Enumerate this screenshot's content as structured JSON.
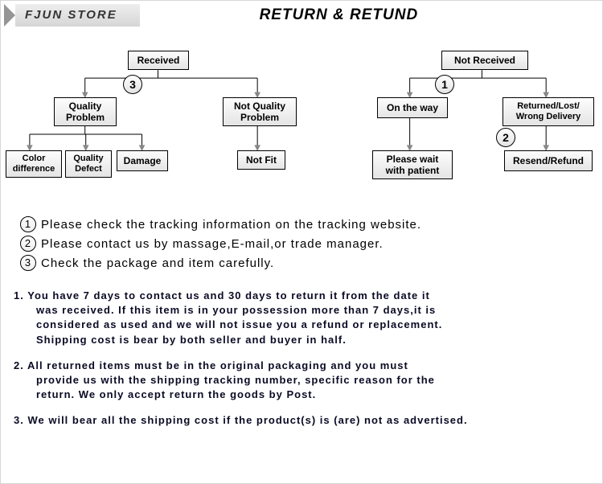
{
  "header": {
    "store_name": "FJUN STORE",
    "title": "RETURN & RETUND"
  },
  "diagram": {
    "left": {
      "root": "Received",
      "step_num": "3",
      "child1": "Quality\nProblem",
      "child2": "Not Quality\nProblem",
      "leaf1": "Color\ndifference",
      "leaf2": "Quality\nDefect",
      "leaf3": "Damage",
      "leaf4": "Not Fit"
    },
    "right": {
      "root": "Not  Received",
      "step_num1": "1",
      "step_num2": "2",
      "child1": "On the way",
      "child2": "Returned/Lost/\nWrong Delivery",
      "leaf1": "Please wait\nwith patient",
      "leaf2": "Resend/Refund"
    }
  },
  "notes": {
    "n1_num": "1",
    "n1": "Please check the tracking information on the tracking website.",
    "n2_num": "2",
    "n2": "Please contact us by  massage,E-mail,or trade manager.",
    "n3_num": "3",
    "n3": "Check the package and item carefully."
  },
  "policy": {
    "p1_label": "1.",
    "p1_a": "You have 7 days to contact us and 30 days to return it from the date it",
    "p1_b": "was received. If this item is in your possession more than 7 days,it is",
    "p1_c": "considered as used and we will not issue you a refund or replacement.",
    "p1_d": "Shipping cost is bear by both seller and buyer in half.",
    "p2_label": "2.",
    "p2_a": "All returned items must be in the original packaging and you must",
    "p2_b": "provide us with the shipping tracking number, specific reason for the",
    "p2_c": "return. We only accept return the goods by Post.",
    "p3_label": "3.",
    "p3_a": "We will bear all the shipping cost if the product(s) is (are) not as advertised."
  }
}
